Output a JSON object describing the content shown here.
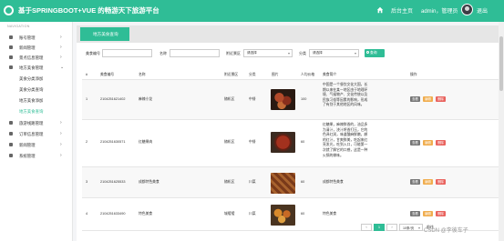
{
  "header": {
    "title": "基于SPRINGBOOT+VUE 的畅游天下旅游平台",
    "home_label": "后台主页",
    "user_label": "admin，管理员",
    "logout_label": "退出"
  },
  "sidebar": {
    "heading": "NAVIGATION",
    "items": [
      {
        "label": "账号管理"
      },
      {
        "label": "新闻管理"
      },
      {
        "label": "景点信息管理"
      },
      {
        "label": "地方美食管理"
      }
    ],
    "sub_items": [
      {
        "label": "美食分类添加"
      },
      {
        "label": "美食分类查询"
      },
      {
        "label": "地方美食添加"
      },
      {
        "label": "地方美食查询"
      }
    ],
    "items_after": [
      {
        "label": "旅游线路管理"
      },
      {
        "label": "订单信息管理"
      },
      {
        "label": "新闻管理"
      },
      {
        "label": "系统管理"
      }
    ]
  },
  "panel": {
    "tab_label": "地方美食查询"
  },
  "filters": {
    "code_label": "美食编号",
    "name_label": "名称",
    "type_label": "附近景区",
    "type_value": "请选择",
    "cuisine_label": "分类",
    "cuisine_value": "请选择",
    "search_label": "查询"
  },
  "table": {
    "headers": [
      "#",
      "美食编号",
      "名称",
      "附近景区",
      "分类",
      "图片",
      "人均价格",
      "美食简介",
      "操作"
    ],
    "rows": [
      {
        "idx": "1",
        "code": "2104251621402",
        "name": "麻辣小龙",
        "spot": "随机区",
        "category": "中餐",
        "price": "100",
        "desc": "中国是一个餐饮文化大国，长期以来在某一地区由于地理环境、气候物产、文化传统以及民族习俗等因素的影响，形成了有别于其他地区的风味。"
      },
      {
        "idx": "2",
        "code": "2104251630571",
        "name": "红糖果肉",
        "spot": "随机区",
        "category": "中餐",
        "price": "60",
        "desc": "红糖果，麻辣鲜香的，油品多为清汁，浇汁将香打压，它的色泽红润，味道酸麻鲜嫩，颇的红汁，甘爽鲜美，吃起来红亮发光，吃到入口，可能第一次就了解它的口感，这是一种火锅的做味。"
      },
      {
        "idx": "3",
        "code": "2104251625533",
        "name": "成都特色美食",
        "spot": "随机区",
        "category": "川菜",
        "price": "60",
        "desc": "成都特色美食"
      },
      {
        "idx": "4",
        "code": "2104251633490",
        "name": "特色美食",
        "spot": "城嗳嗳",
        "category": "川菜",
        "price": "60",
        "desc": "特色美食"
      }
    ],
    "action_labels": {
      "view": "查看",
      "edit": "编辑",
      "delete": "删除"
    }
  },
  "pager": {
    "prev": "‹",
    "page": "1",
    "next": "›",
    "per_page": "10条/页",
    "goto_label": "前往"
  },
  "watermark": "CSDN @李彼车子"
}
